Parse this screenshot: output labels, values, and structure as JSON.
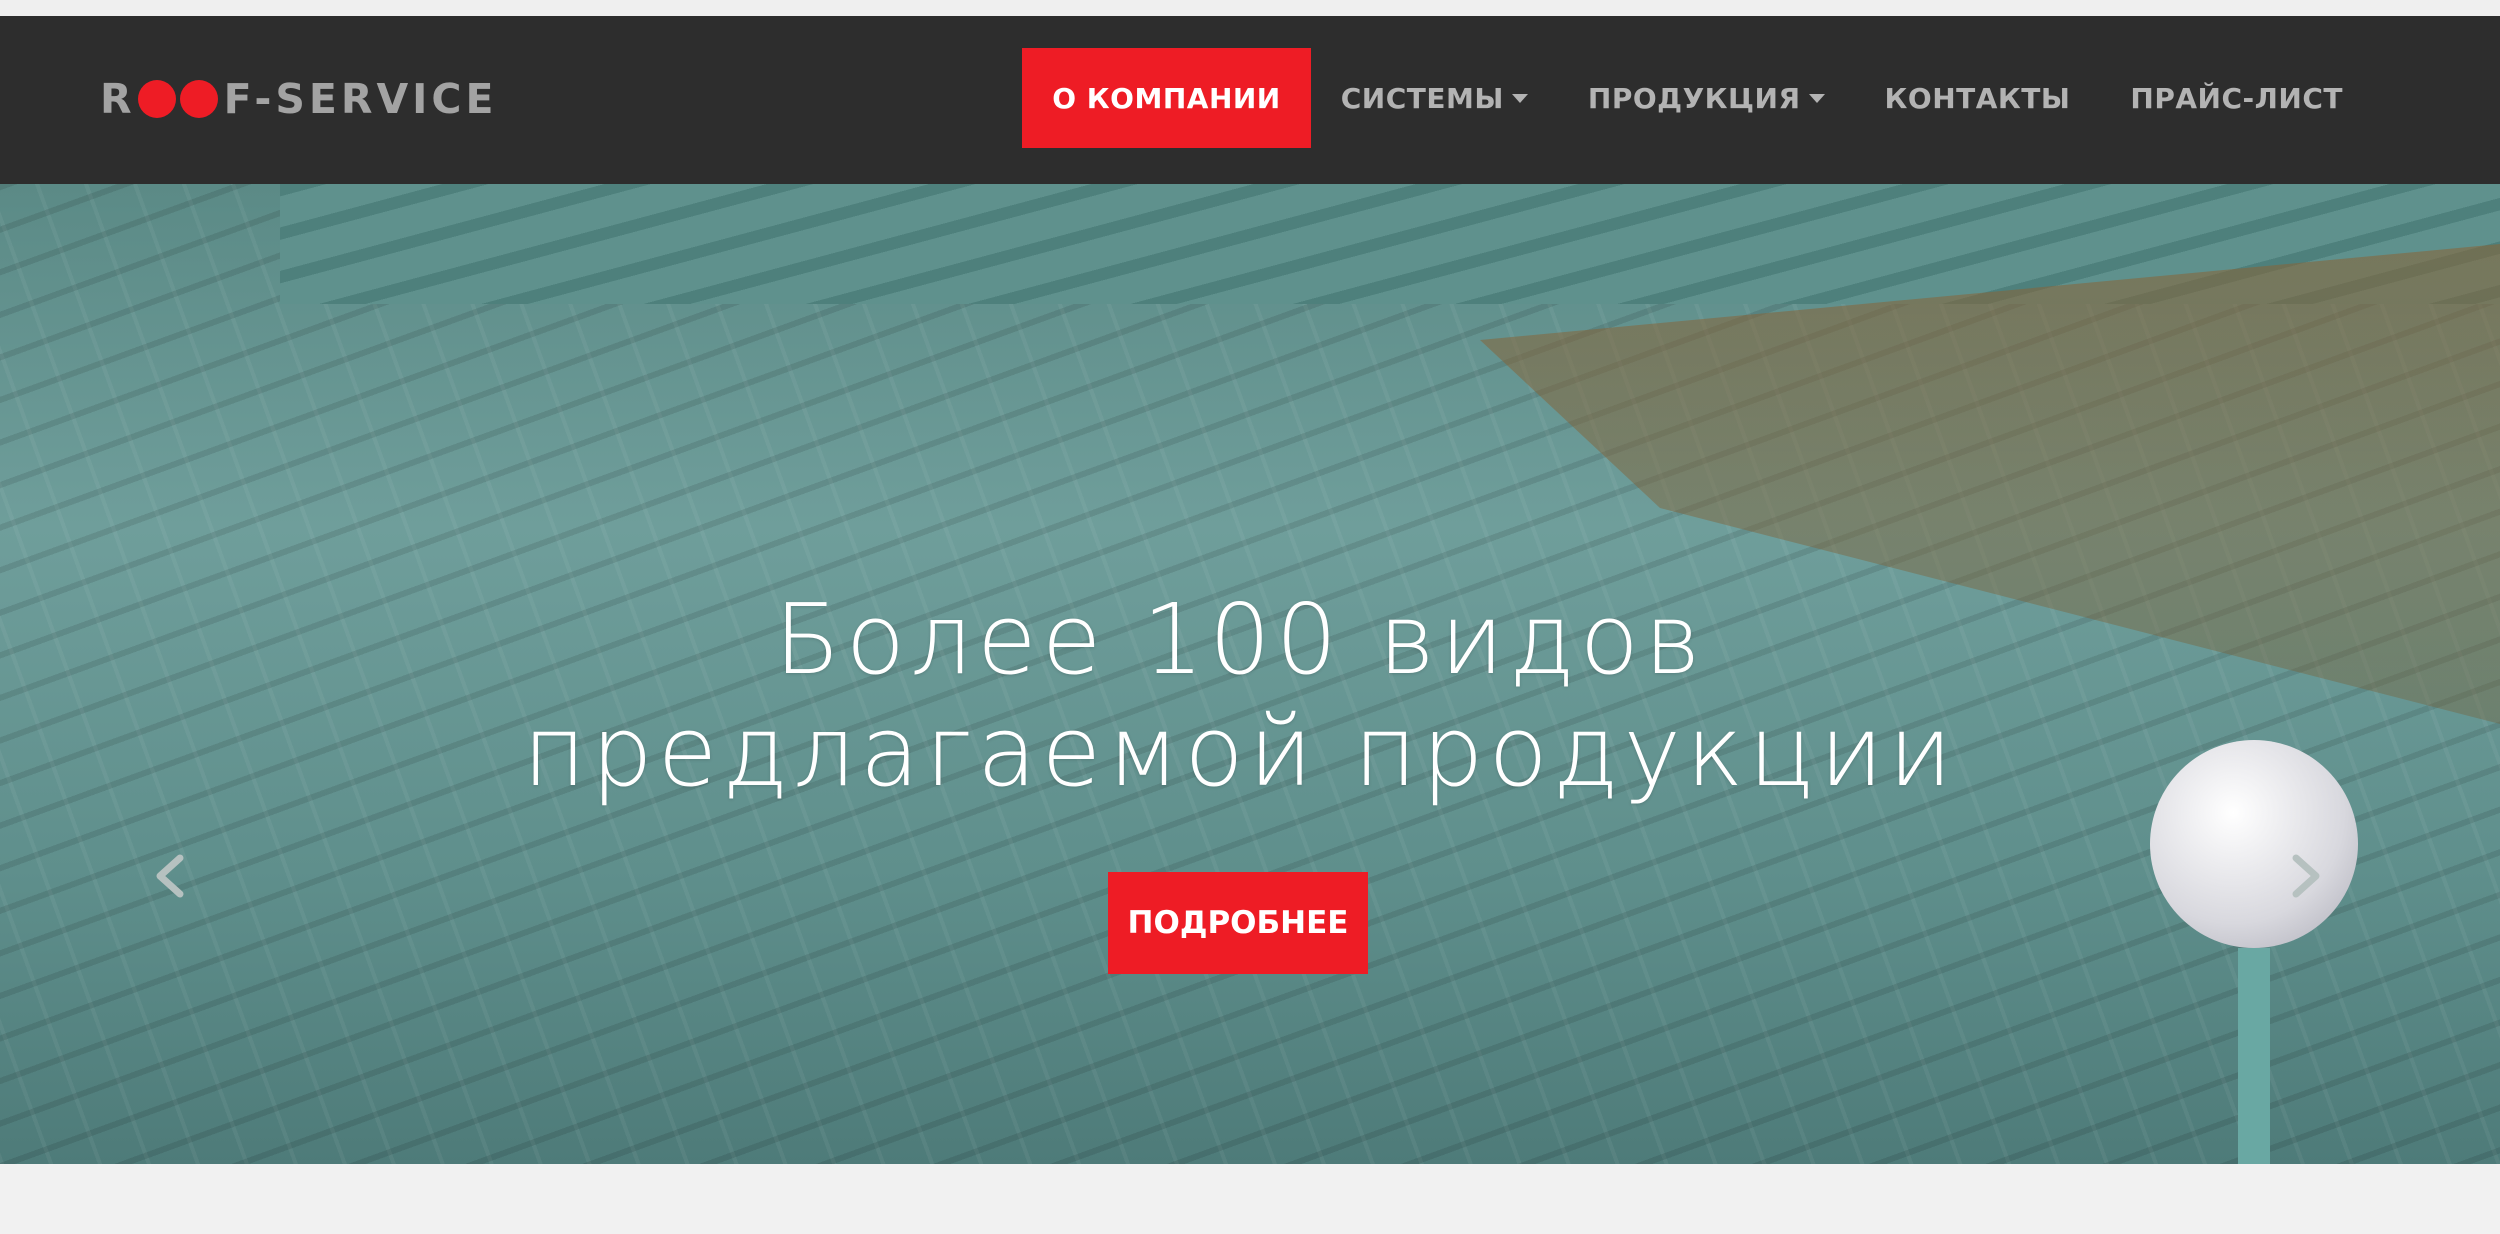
{
  "colors": {
    "accent": "#ee1c25",
    "navbar": "#2d2d2d",
    "nav_text": "#b3b3b3",
    "page_bg": "#f1f1f1"
  },
  "logo": {
    "prefix": "R",
    "suffix": "F-SERVICE"
  },
  "nav": {
    "items": [
      {
        "label": "О КОМПАНИИ",
        "active": true
      },
      {
        "label": "СИСТЕМЫ",
        "has_dropdown": true
      },
      {
        "label": "ПРОДУКЦИЯ",
        "has_dropdown": true
      },
      {
        "label": "КОНТАКТЫ"
      },
      {
        "label": "ПРАЙС-ЛИСТ"
      }
    ]
  },
  "hero": {
    "headline_line1": "Более 100 видов",
    "headline_line2": "предлагаемой продукции",
    "cta_label": "ПОДРОБНЕЕ",
    "prev_icon": "chevron-left-icon",
    "next_icon": "chevron-right-icon"
  }
}
